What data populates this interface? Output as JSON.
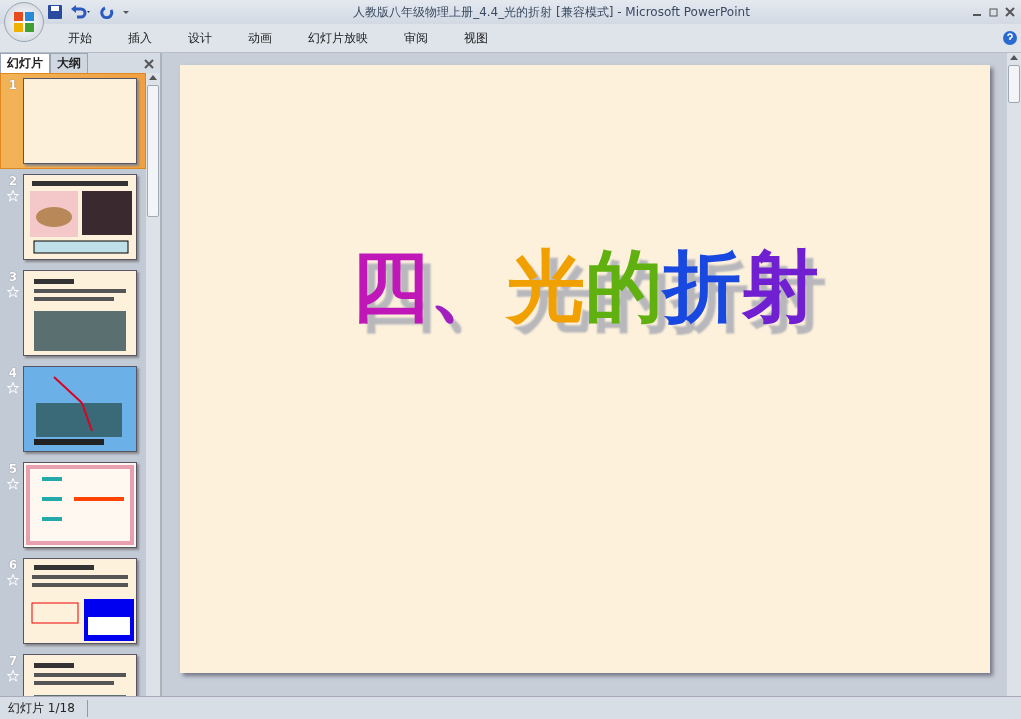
{
  "window": {
    "title": "人教版八年级物理上册_4.4_光的折射 [兼容模式] - Microsoft PowerPoint"
  },
  "ribbon_tabs": [
    {
      "label": "开始",
      "selected": false
    },
    {
      "label": "插入",
      "selected": false
    },
    {
      "label": "设计",
      "selected": false
    },
    {
      "label": "动画",
      "selected": false
    },
    {
      "label": "幻灯片放映",
      "selected": false
    },
    {
      "label": "审阅",
      "selected": false
    },
    {
      "label": "视图",
      "selected": false
    }
  ],
  "pane_tabs": [
    {
      "label": "幻灯片",
      "selected": true
    },
    {
      "label": "大纲",
      "selected": false
    }
  ],
  "slides": [
    {
      "number": "1",
      "selected": true,
      "animated": false,
      "kind": "title"
    },
    {
      "number": "2",
      "selected": false,
      "animated": true,
      "kind": "photos"
    },
    {
      "number": "3",
      "selected": false,
      "animated": true,
      "kind": "text-photo"
    },
    {
      "number": "4",
      "selected": false,
      "animated": true,
      "kind": "diagram-blue"
    },
    {
      "number": "5",
      "selected": false,
      "animated": true,
      "kind": "frame"
    },
    {
      "number": "6",
      "selected": false,
      "animated": true,
      "kind": "text-diagram"
    },
    {
      "number": "7",
      "selected": false,
      "animated": true,
      "kind": "text-photo"
    }
  ],
  "slide": {
    "title_chars": [
      {
        "text": "四",
        "color": "#c018b8"
      },
      {
        "text": "、",
        "color": "#a020c0"
      },
      {
        "text": "光",
        "color": "#f0a000"
      },
      {
        "text": "的",
        "color": "#60b010"
      },
      {
        "text": "折",
        "color": "#1848e0"
      },
      {
        "text": "射",
        "color": "#7020d0"
      }
    ]
  },
  "status_bar": {
    "text": "幻灯片 1/18"
  }
}
